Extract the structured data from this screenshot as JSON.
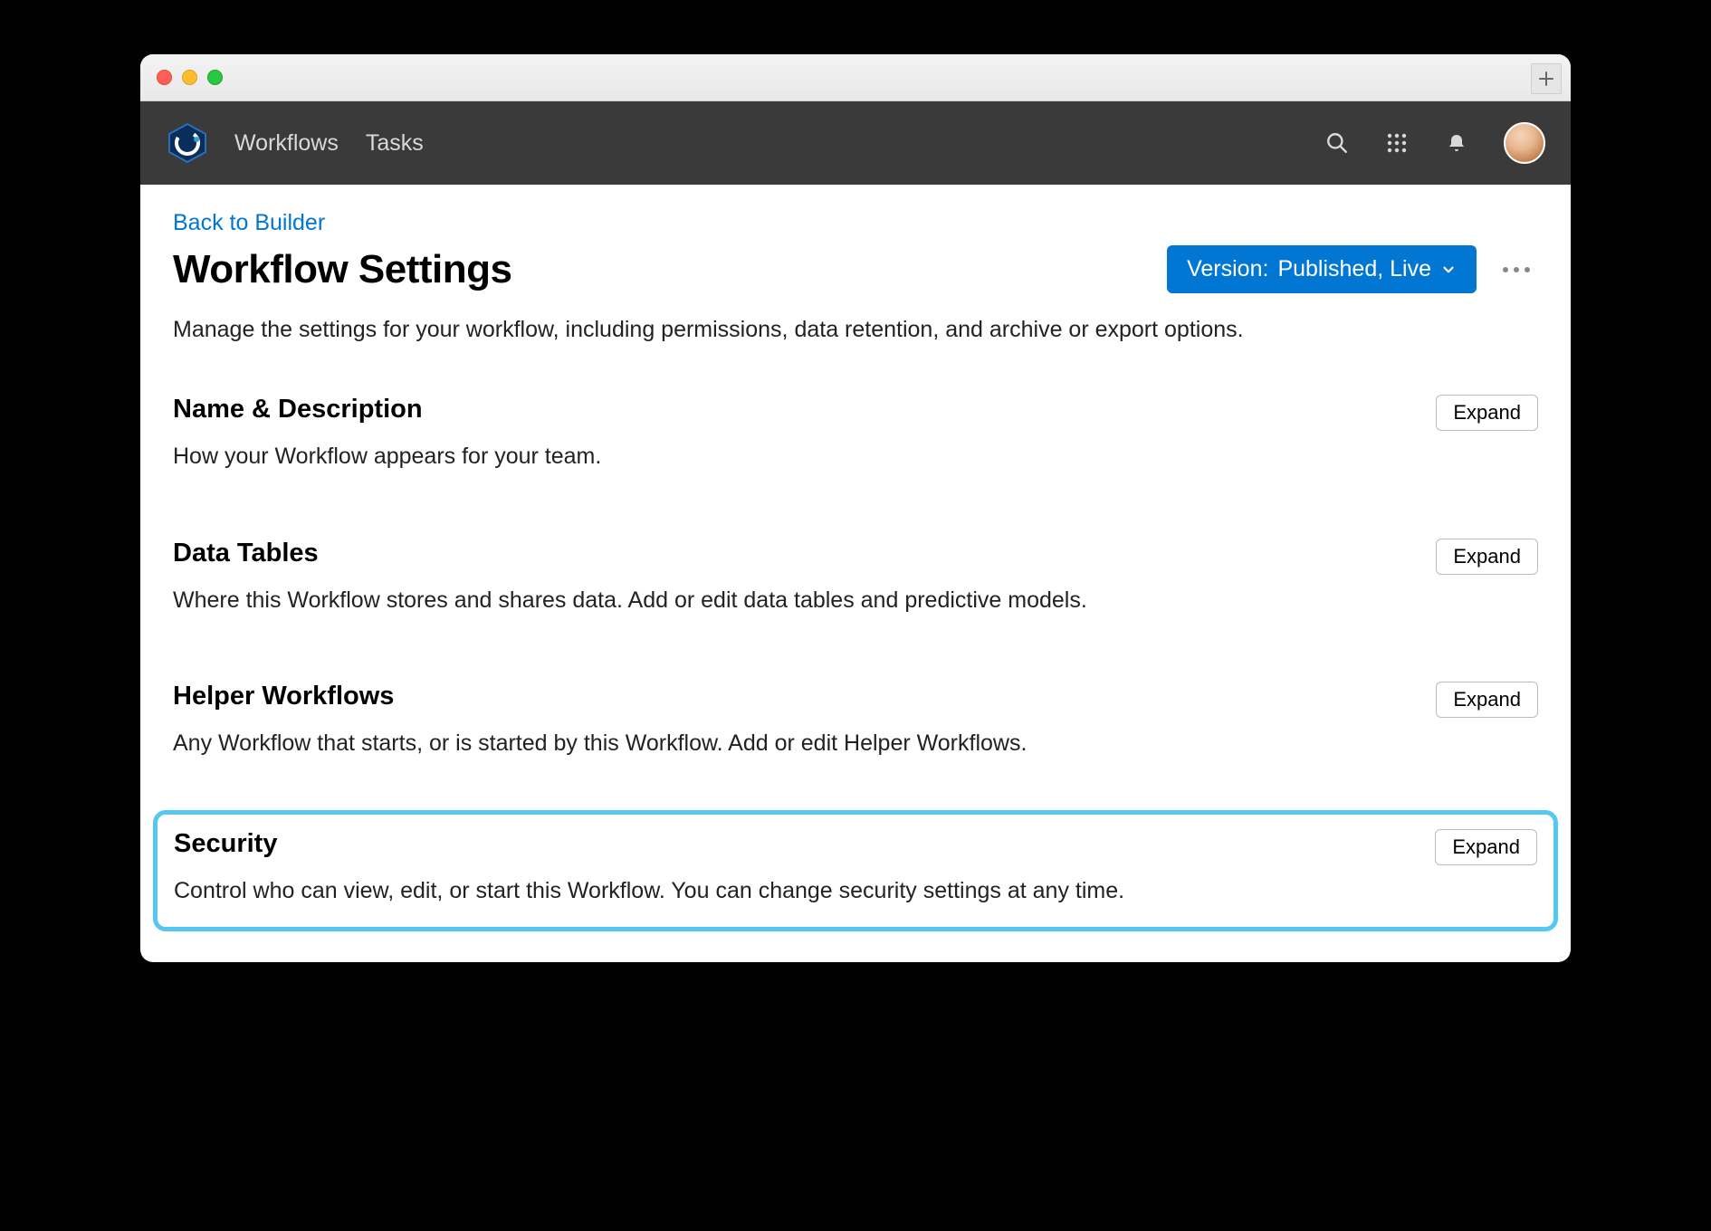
{
  "nav": {
    "links": [
      "Workflows",
      "Tasks"
    ]
  },
  "page": {
    "back_link": "Back to Builder",
    "title": "Workflow Settings",
    "version_label": "Version:",
    "version_value": "Published, Live",
    "subtitle": "Manage the settings for your workflow, including permissions, data retention, and archive or export options."
  },
  "sections": [
    {
      "title": "Name & Description",
      "desc": "How your Workflow appears for your team.",
      "expand": "Expand",
      "highlight": false
    },
    {
      "title": "Data Tables",
      "desc": "Where this Workflow stores and shares data. Add or edit data tables and predictive models.",
      "expand": "Expand",
      "highlight": false
    },
    {
      "title": "Helper Workflows",
      "desc": "Any Workflow that starts, or is started by this Workflow. Add or edit Helper Workflows.",
      "expand": "Expand",
      "highlight": false
    },
    {
      "title": "Security",
      "desc": "Control who can view, edit, or start this Workflow. You can change security settings at any time.",
      "expand": "Expand",
      "highlight": true
    }
  ]
}
